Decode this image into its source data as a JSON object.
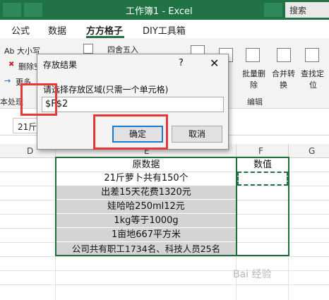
{
  "window": {
    "title": "工作簿1  -  Excel",
    "search": "搜索"
  },
  "tabs": [
    {
      "label": "公式"
    },
    {
      "label": "数据"
    },
    {
      "label": "方方格子"
    },
    {
      "label": "DIY工具箱"
    }
  ],
  "ribbon": {
    "items": {
      "size": "Ab 大小写",
      "delete": "删除空",
      "more": "更多",
      "round": "四舍五入",
      "batch_delete_line1": "批量删",
      "batch_delete_line2": "除",
      "merge_line1": "合并转",
      "merge_line2": "换",
      "find_line1": "查找定",
      "find_line2": "位"
    },
    "group_labels": {
      "text_processing": "本处理",
      "edit": "编辑"
    }
  },
  "formula_bar": {
    "namebox": "21斤"
  },
  "columns": [
    "D",
    "E",
    "F",
    "G"
  ],
  "table": {
    "header": "原数据",
    "f_header": "数值",
    "rows": [
      "21斤萝卜共有150个",
      "出差15天花费1320元",
      "娃哈哈250ml12元",
      "1kg等于1000g",
      "1亩地667平方米",
      "公司共有职工1734名、科技人员25名"
    ]
  },
  "dialog": {
    "title": "存放结果",
    "help": "?",
    "close": "✕",
    "label": "请选择存放区域(只需一个单元格)",
    "input_value": "$F$2",
    "ok": "确定",
    "cancel": "取消"
  },
  "watermark": "Bai 经验"
}
